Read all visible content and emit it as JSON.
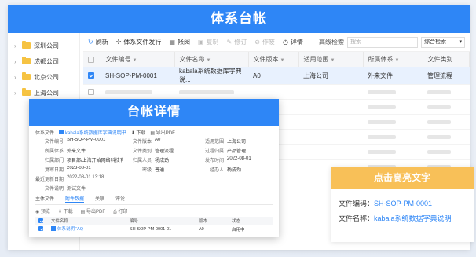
{
  "main": {
    "title": "体系台帐",
    "tree": [
      "深圳公司",
      "成都公司",
      "北京公司",
      "上海公司"
    ],
    "toolbar": {
      "refresh": "刷新",
      "issue": "体系文件发行",
      "ledger": "帐阅",
      "copy": "复制",
      "modify": "修订",
      "void": "作废",
      "detail": "详情"
    },
    "search": {
      "label": "高级检索",
      "placeholder": "搜索"
    },
    "sort_select": "综合检索",
    "columns": [
      "文件编号",
      "文件名称",
      "文件版本",
      "适用范围",
      "所属体系",
      "文件类别"
    ],
    "selected_row": {
      "number": "SH-SOP-PM-0001",
      "name": "kabala系统数据库字典说...",
      "version": "A0",
      "scope": "上海公司",
      "system": "外来文件",
      "category": "管理流程"
    }
  },
  "detail": {
    "title": "台帐详情",
    "top_label": "体系文件",
    "top_doc": "kabala系统数据库字典说明书",
    "download": "下载",
    "export_pdf": "导出PDF",
    "fields": [
      [
        "文件编号",
        "SH-SOP-PM-0001",
        "文件版本",
        "A0",
        "适用范围",
        "上海公司"
      ],
      [
        "所属体系",
        "外来文件",
        "文件类别",
        "管理流程",
        "过程归属",
        "产品管理"
      ],
      [
        "归属部门",
        "项目部/上海开始网络科技有限公...",
        "归属人员",
        "杨成劲",
        "发布时间",
        "2022-08-01"
      ],
      [
        "复审日期",
        "2023-08-01",
        "密级",
        "普通",
        "经办人",
        "杨成劲"
      ]
    ],
    "last_update_label": "最近更新日期",
    "last_update": "2022-08-01 13:18",
    "note_label": "文件说明",
    "note": "测试文件",
    "tabs": [
      "主体文件",
      "附件数据",
      "关联",
      "评论"
    ],
    "actions": [
      "预览",
      "下载",
      "导出PDF",
      "打印"
    ],
    "table_columns": [
      "文件名称",
      "编号",
      "版本",
      "状态"
    ],
    "table_row": {
      "name": "体系说明FAQ",
      "number": "SH-SOP-PM-0001-01",
      "version": "A0",
      "status": "启用中"
    }
  },
  "callout": {
    "title": "点击高亮文字",
    "number_label": "文件编码：",
    "number_value": "SH-SOP-PM-0001",
    "name_label": "文件名称：",
    "name_value": "kabala系统数据字典说明"
  },
  "colors": {
    "accent": "#2e86f6",
    "callout": "#f8c058"
  },
  "icons": [
    "refresh-icon",
    "issue-icon",
    "ledger-icon",
    "copy-icon",
    "modify-icon",
    "void-icon",
    "detail-icon",
    "folder-icon",
    "chevron-right-icon",
    "filter-icon"
  ]
}
